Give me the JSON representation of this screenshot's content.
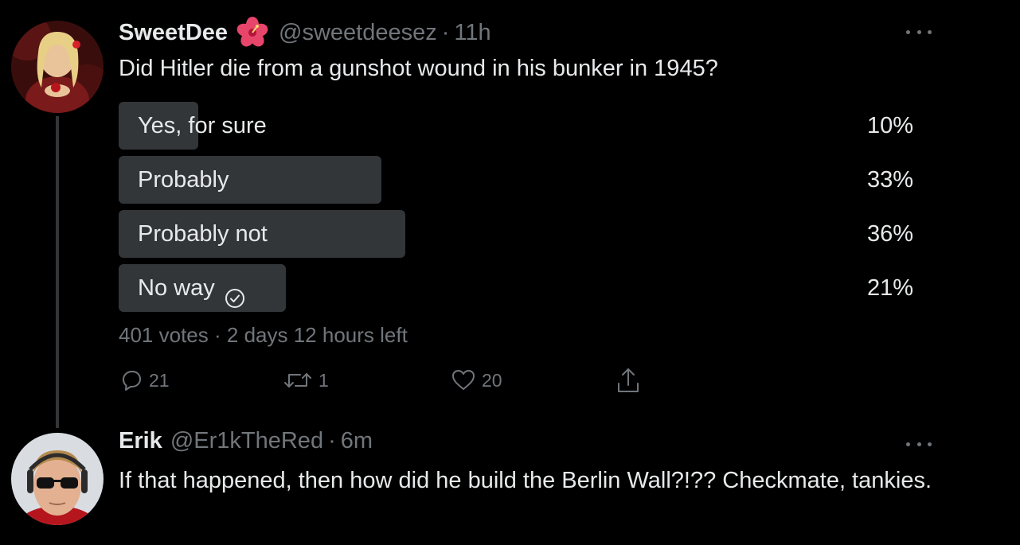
{
  "tweet": {
    "author_name": "SweetDee",
    "author_emoji": "hibiscus-emoji",
    "author_handle": "@sweetdeesez",
    "separator": "·",
    "time": "11h",
    "text": "Did Hitler die from a gunshot wound in his bunker in 1945?",
    "poll": {
      "options": [
        {
          "label": "Yes, for sure",
          "percent_label": "10%",
          "percent": 10,
          "selected": false
        },
        {
          "label": "Probably",
          "percent_label": "33%",
          "percent": 33,
          "selected": false
        },
        {
          "label": "Probably not",
          "percent_label": "36%",
          "percent": 36,
          "selected": false
        },
        {
          "label": "No way",
          "percent_label": "21%",
          "percent": 21,
          "selected": true
        }
      ],
      "votes": "401 votes",
      "separator": "·",
      "time_left": "2 days 12 hours left"
    },
    "actions": {
      "reply_count": "21",
      "retweet_count": "1",
      "like_count": "20"
    }
  },
  "reply": {
    "author_name": "Erik",
    "author_handle": "@Er1kTheRed",
    "separator": "·",
    "time": "6m",
    "text": "If that happened, then how did he build the Berlin Wall?!?? Checkmate, tankies."
  },
  "colors": {
    "background": "#000000",
    "primary_text": "#e7e9ea",
    "secondary_text": "#71767b",
    "poll_bar": "#333639",
    "thread_line": "#333639"
  }
}
